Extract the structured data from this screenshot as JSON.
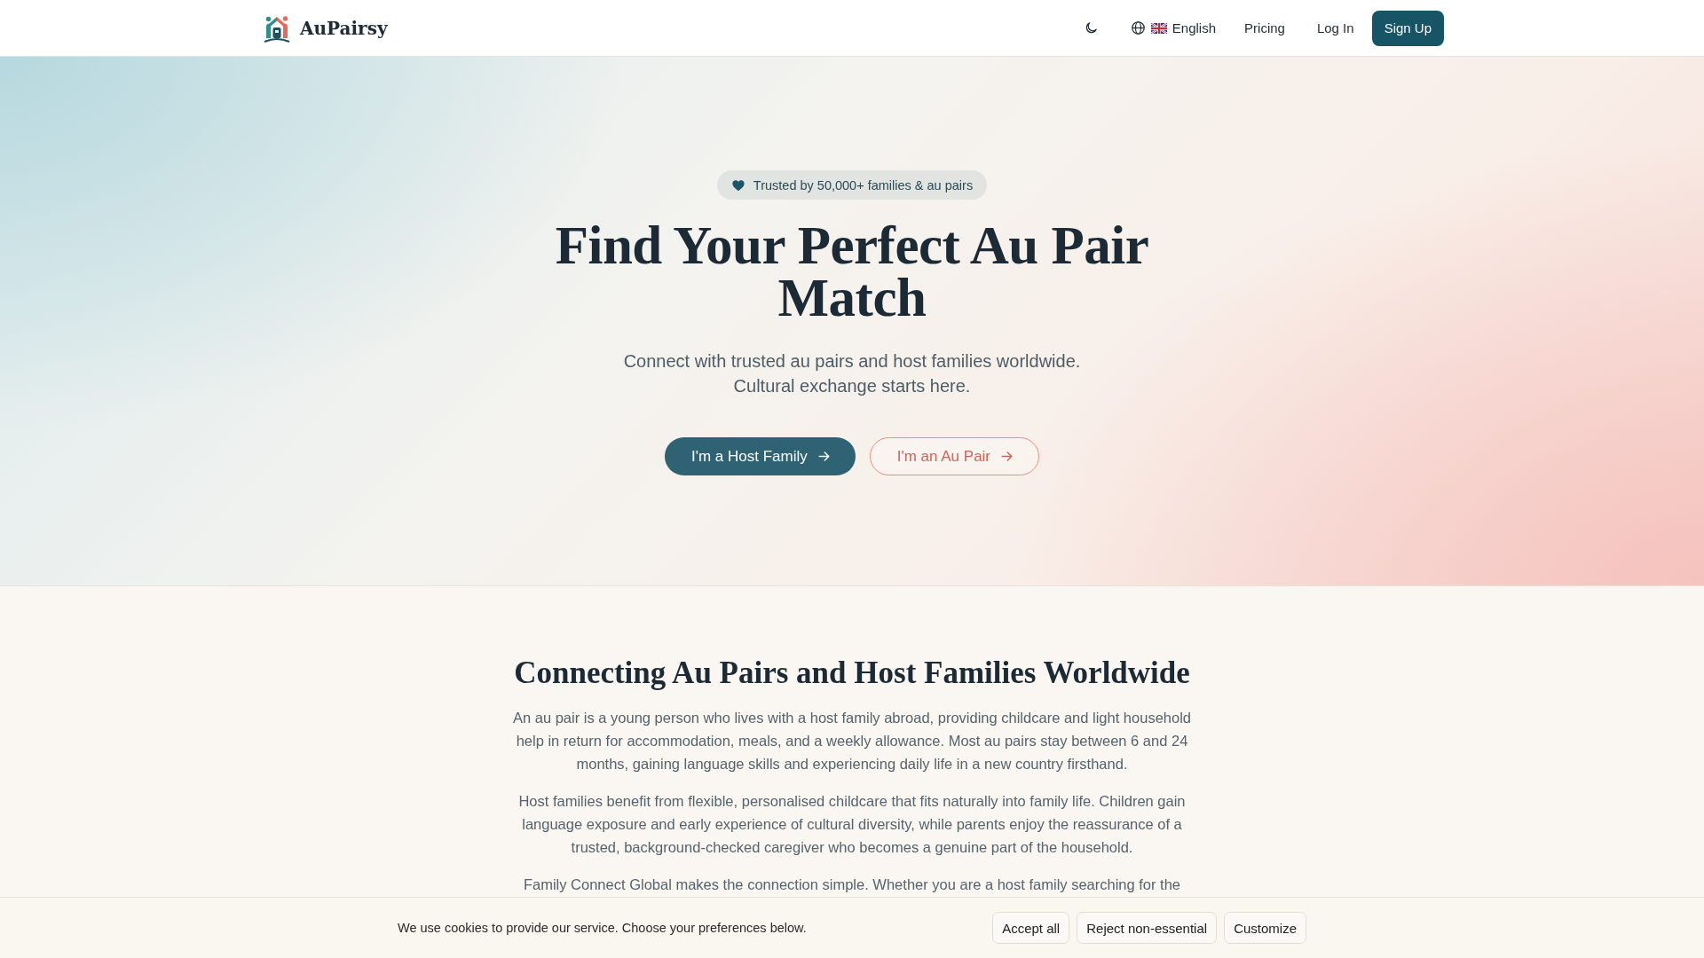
{
  "header": {
    "logo": "AuPairsy",
    "language": "English",
    "nav_links": [
      "Pricing",
      "Log In"
    ],
    "signup_button": "Sign Up"
  },
  "hero": {
    "badge": "Trusted by 50,000+ families & au pairs",
    "title": "Find Your Perfect Au Pair Match",
    "subtitle": "Connect with trusted au pairs and host families worldwide. Cultural exchange starts here.",
    "buttons": [
      {
        "label": "I'm a Host Family",
        "kind": "primary"
      },
      {
        "label": "I'm an Au Pair",
        "kind": "outline"
      }
    ]
  },
  "about": {
    "title": "Connecting Au Pairs and Host Families Worldwide",
    "paragraphs": [
      "An au pair is a young person who lives with a host family abroad, providing childcare and light household help in return for accommodation, meals, and a weekly allowance. Most au pairs stay between 6 and 24 months, gaining language skills and experiencing daily life in a new country firsthand.",
      "Host families benefit from flexible, personalised childcare that fits naturally into family life. Children gain language exposure and early experience of cultural diversity, while parents enjoy the reassurance of a trusted, background-checked caregiver who becomes a genuine part of the household.",
      "Family Connect Global makes the connection simple. Whether you are a host family searching for the"
    ]
  },
  "cookie_banner": {
    "message": "We use cookies to provide our service. Choose your preferences below.",
    "buttons": [
      "Accept all",
      "Reject non-essential",
      "Customize"
    ]
  }
}
